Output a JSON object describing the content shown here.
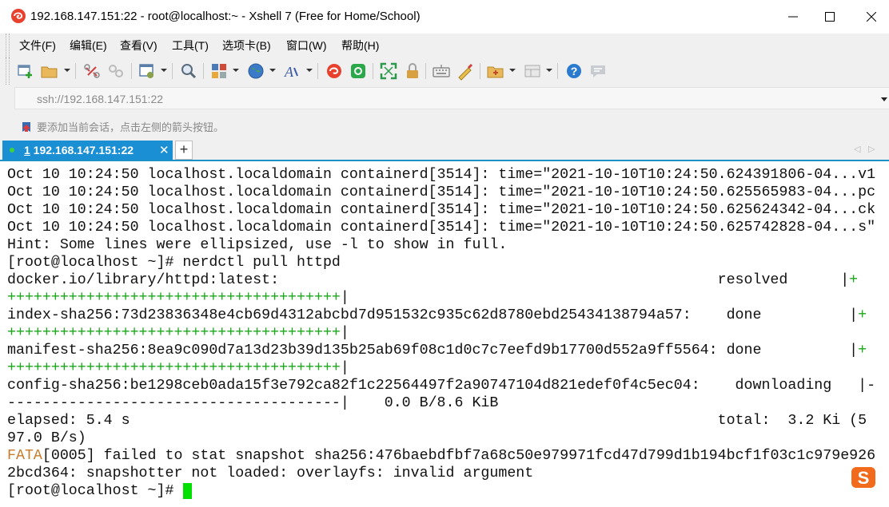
{
  "window": {
    "title": "192.168.147.151:22 - root@localhost:~ - Xshell 7 (Free for Home/School)",
    "minimize_glyph": "—",
    "maximize_glyph": "☐",
    "close_glyph": "✕"
  },
  "menu": {
    "items": [
      {
        "label": "文件(F)"
      },
      {
        "label": "编辑(E)"
      },
      {
        "label": "查看(V)"
      },
      {
        "label": "工具(T)"
      },
      {
        "label": "选项卡(B)"
      },
      {
        "label": "窗口(W)"
      },
      {
        "label": "帮助(H)"
      }
    ]
  },
  "toolbar": {
    "icons": [
      "new-session-icon",
      "open-folder-icon",
      "disconnect-icon",
      "reconnect-icon",
      "properties-icon",
      "find-icon",
      "layout-icon",
      "globe-icon",
      "font-icon",
      "xshell-icon",
      "xftp-icon",
      "fullscreen-icon",
      "lock-icon",
      "keyboard-icon",
      "script-icon",
      "new-folder-icon",
      "layout-grid-icon",
      "help-icon",
      "chat-icon"
    ]
  },
  "address": {
    "value": "ssh://192.168.147.151:22"
  },
  "hint": {
    "text": "要添加当前会话，点击左侧的箭头按钮。"
  },
  "tabs": [
    {
      "number": "1",
      "label": " 192.168.147.151:22",
      "close": "✕"
    }
  ],
  "tab_add": "+",
  "tab_nav": {
    "prev": "◁",
    "next": "▷"
  },
  "terminal": {
    "lines": [
      {
        "text": "Oct 10 10:24:50 localhost.localdomain containerd[3514]: time=\"2021-10-10T10:24:50.624391806-04...v1"
      },
      {
        "text": "Oct 10 10:24:50 localhost.localdomain containerd[3514]: time=\"2021-10-10T10:24:50.625565983-04...pc"
      },
      {
        "text": "Oct 10 10:24:50 localhost.localdomain containerd[3514]: time=\"2021-10-10T10:24:50.625624342-04...ck"
      },
      {
        "text": "Oct 10 10:24:50 localhost.localdomain containerd[3514]: time=\"2021-10-10T10:24:50.625742828-04...s\""
      },
      {
        "text": "Hint: Some lines were ellipsized, use -l to show in full."
      },
      {
        "text": "[root@localhost ~]# nerdctl pull httpd"
      },
      {
        "text": "docker.io/library/httpd:latest:                                                  resolved      |",
        "tail": "+"
      },
      {
        "text": "",
        "green": "++++++++++++++++++++++++++++++++++++++",
        "tail2": "|"
      },
      {
        "text": "index-sha256:73d23836348e4cb69d4312abcbd7d951532c935c62d8780ebd25434138794a57:    done          |",
        "tail": "+"
      },
      {
        "text": "",
        "green": "++++++++++++++++++++++++++++++++++++++",
        "tail2": "|"
      },
      {
        "text": "manifest-sha256:8ea9c090d7a13d23b39d135b25ab69f08c1d0c7c7eefd9b17700d552a9ff5564: done          |",
        "tail": "+"
      },
      {
        "text": "",
        "green": "++++++++++++++++++++++++++++++++++++++",
        "tail2": "|"
      },
      {
        "text": "config-sha256:be1298ceb0ada15f3e792ca82f1c22564497f2a90747104d821edef0f4c5ec04:    downloading   |-"
      },
      {
        "text": "--------------------------------------|    0.0 B/8.6 KiB"
      },
      {
        "text": "elapsed: 5.4 s                                                                   total:  3.2 Ki (5"
      },
      {
        "text": "97.0 B/s)"
      },
      {
        "text": "",
        "orange": "FATA",
        "rest": "[0005] failed to stat snapshot sha256:476baebdfbf7a68c50e979971fcd47d799d1b194bcf1f03c1c979e926"
      },
      {
        "text": "2bcd364: snapshotter not loaded: overlayfs: invalid argument"
      },
      {
        "text": "[root@localhost ~]# "
      }
    ]
  },
  "colors": {
    "tab_active": "#1a8fd4",
    "progress_green": "#18a818",
    "fata_orange": "#c87a2a",
    "cursor": "#00e000"
  }
}
